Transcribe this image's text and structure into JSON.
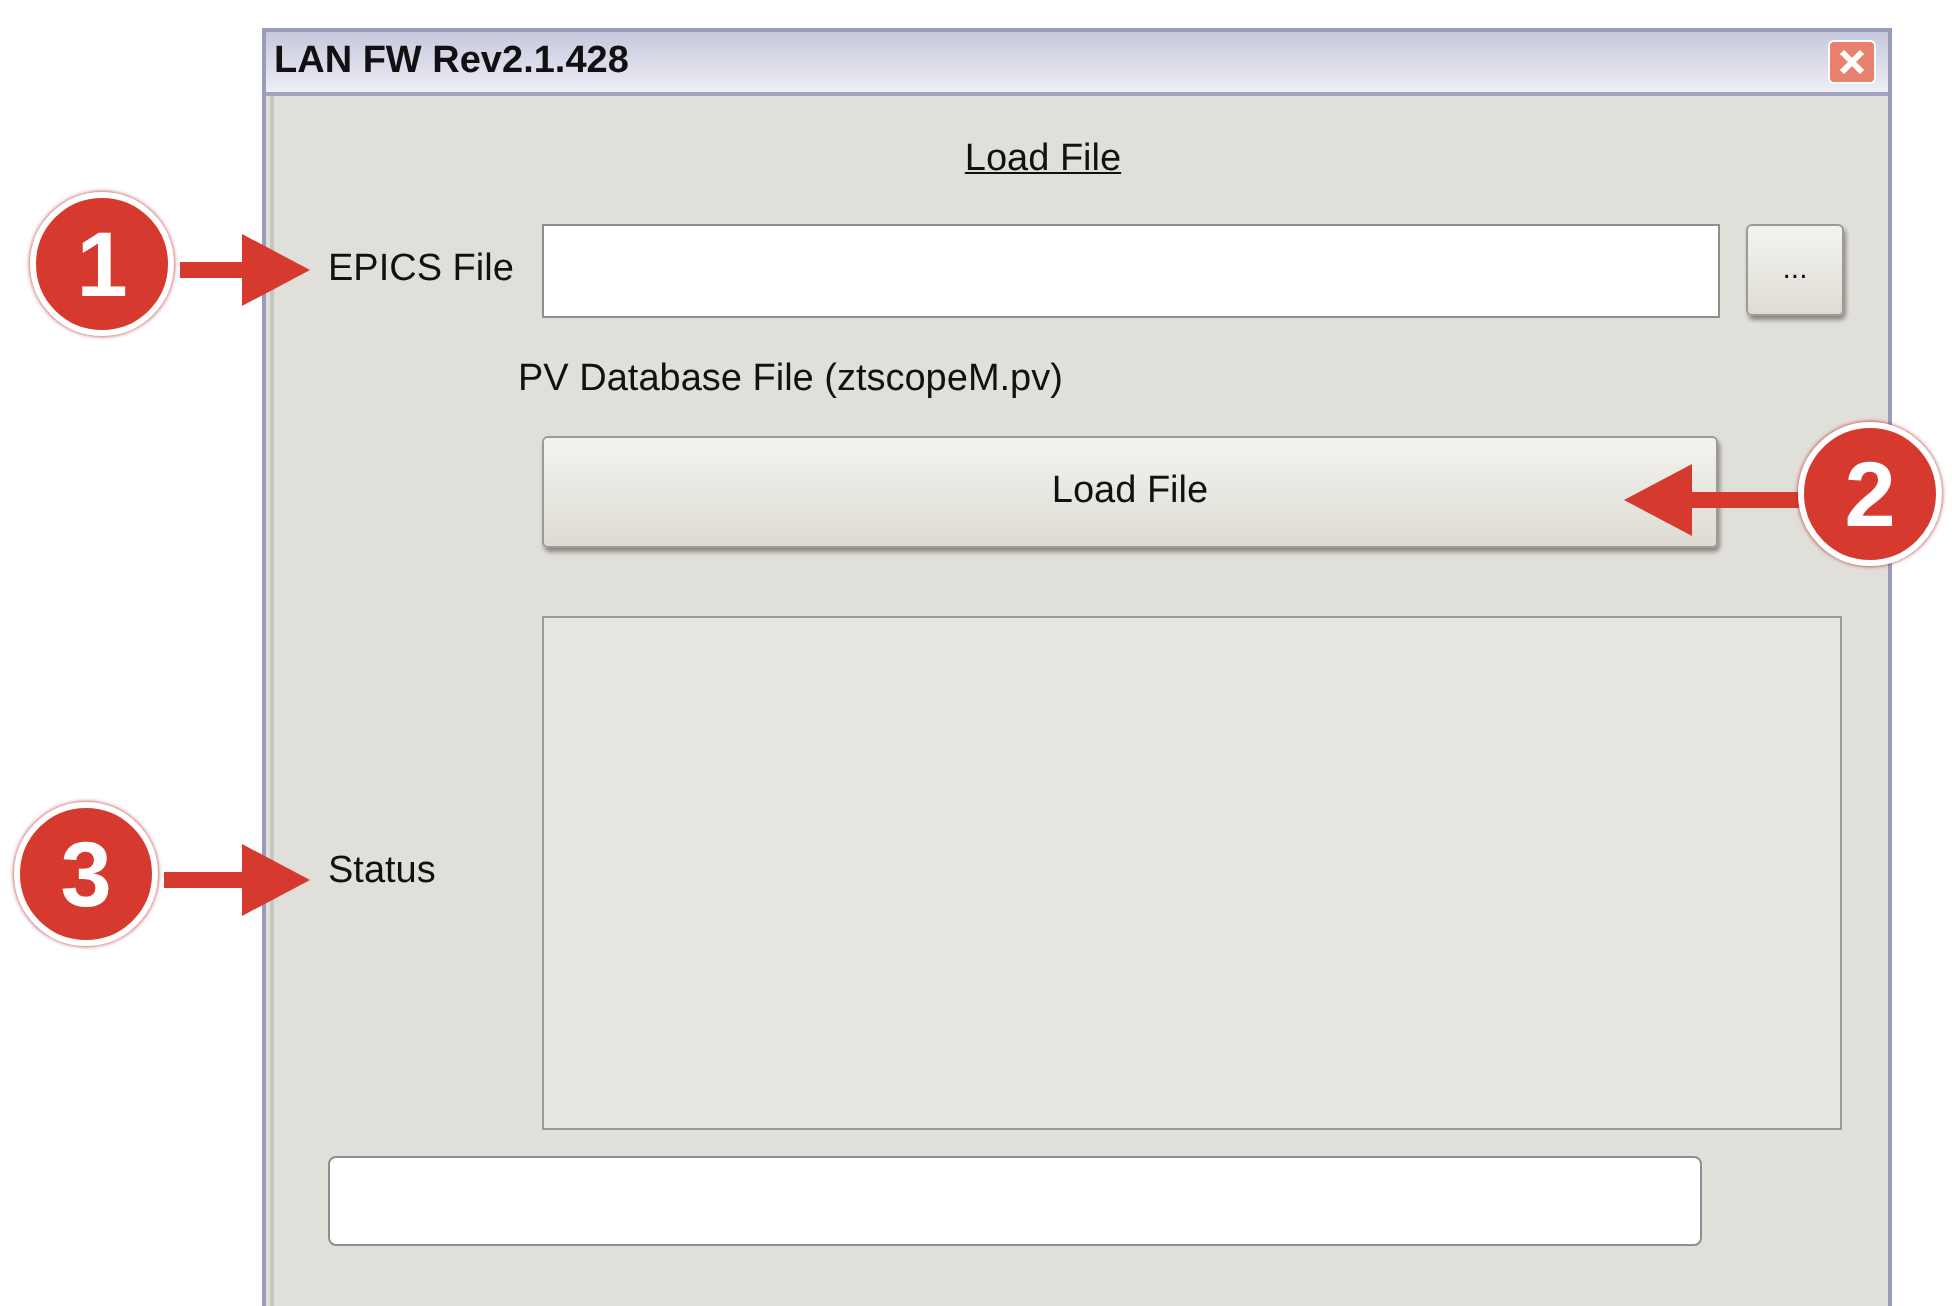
{
  "window": {
    "title": "LAN FW Rev2.1.428"
  },
  "section_title": "Load File",
  "epics_file": {
    "label": "EPICS File",
    "browse_button": "..."
  },
  "pv_database_label": "PV Database File (ztscopeM.pv)",
  "load_button": "Load File",
  "status": {
    "label": "Status"
  },
  "callouts": [
    {
      "number": "1"
    },
    {
      "number": "2"
    },
    {
      "number": "3"
    }
  ]
}
